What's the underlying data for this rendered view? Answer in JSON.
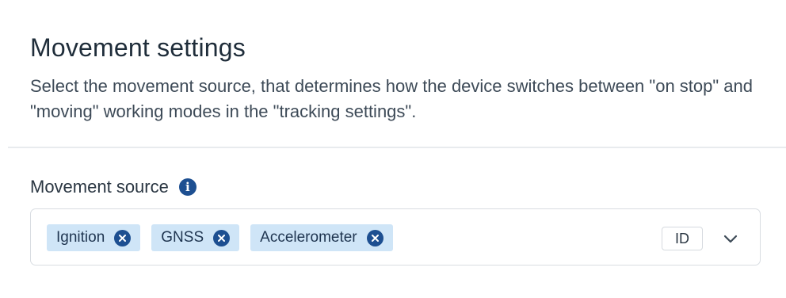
{
  "section": {
    "title": "Movement settings",
    "description": "Select the movement source, that determines how the device switches between \"on stop\" and \"moving\" working modes in the \"tracking settings\"."
  },
  "field": {
    "label": "Movement source",
    "info_icon": "info-icon",
    "selected": [
      {
        "label": "Ignition",
        "remove_icon": "close-circle-icon"
      },
      {
        "label": "GNSS",
        "remove_icon": "close-circle-icon"
      },
      {
        "label": "Accelerometer",
        "remove_icon": "close-circle-icon"
      }
    ],
    "badge": "ID",
    "toggle_icon": "chevron-down-icon"
  },
  "colors": {
    "accent": "#1d4f91",
    "chip_background": "#cfe5f7",
    "border": "#d9dde2",
    "divider": "#e8ebee"
  }
}
